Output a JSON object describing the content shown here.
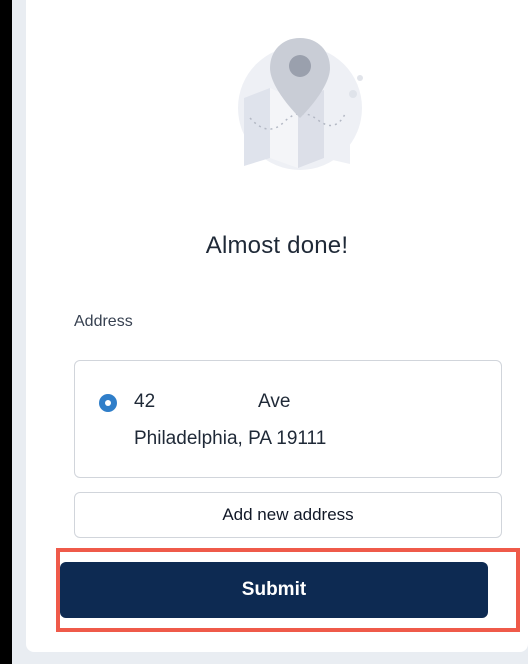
{
  "illustration": {
    "icon": "map-pin-illustration"
  },
  "page": {
    "title": "Almost done!"
  },
  "address_section": {
    "label": "Address",
    "selected_address": {
      "line1_prefix": "42",
      "line1_street": "Ave",
      "line2": "Philadelphia, PA 19111",
      "selected": true
    }
  },
  "actions": {
    "add_new_address": "Add new address",
    "submit": "Submit"
  },
  "colors": {
    "accent_radio": "#2f7ec9",
    "submit_bg": "#0d2a52",
    "highlight_border": "#ef5a4a"
  }
}
